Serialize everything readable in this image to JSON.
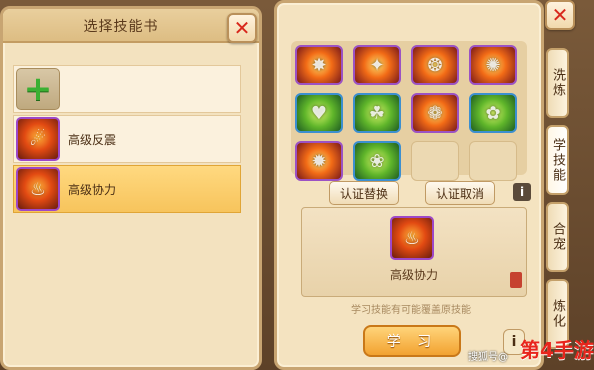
{
  "left_window": {
    "title": "选择技能书",
    "slots": [
      {
        "label": ""
      },
      {
        "label": "高级反震"
      },
      {
        "label": "高级协力",
        "selected": true
      }
    ]
  },
  "right_panel": {
    "buttons": {
      "replace": "认证替换",
      "cancel": "认证取消",
      "info": "i"
    },
    "selected_skill_name": "高级协力",
    "hint": "学习技能有可能覆盖原技能",
    "learn_button": "学 习",
    "info_button": "i"
  },
  "tabs": [
    "洗炼",
    "学技能",
    "合宠",
    "炼化"
  ],
  "active_tab_index": 1,
  "close_label": "✕",
  "watermark": "搜狐号@",
  "brand": "第4手游"
}
